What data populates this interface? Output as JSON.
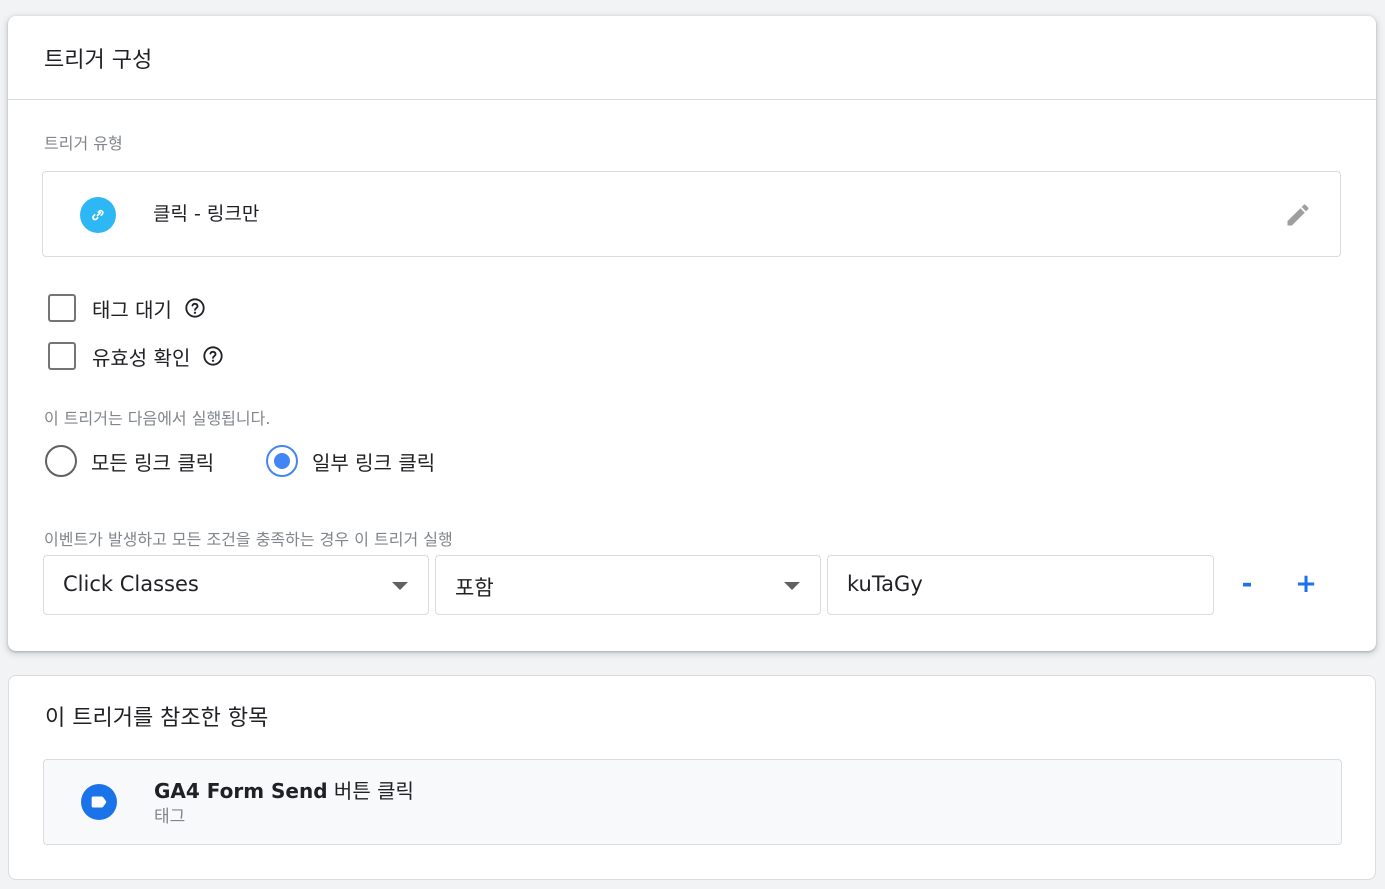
{
  "config": {
    "title": "트리거 구성",
    "type_label": "트리거 유형",
    "trigger_type": "클릭 - 링크만",
    "checkboxes": [
      {
        "label": "태그 대기",
        "checked": false
      },
      {
        "label": "유효성 확인",
        "checked": false
      }
    ],
    "fires_on_label": "이 트리거는 다음에서 실행됩니다.",
    "radio_options": [
      {
        "label": "모든 링크 클릭",
        "selected": false
      },
      {
        "label": "일부 링크 클릭",
        "selected": true
      }
    ],
    "condition_label": "이벤트가 발생하고 모든 조건을 충족하는 경우 이 트리거 실행",
    "condition": {
      "variable": "Click Classes",
      "operator": "포함",
      "value": "kuTaGy"
    },
    "remove_label": "-",
    "add_label": "+"
  },
  "references": {
    "title": "이 트리거를 참조한 항목",
    "items": [
      {
        "name_bold": "GA4 Form Send",
        "name_rest": " 버튼 클릭",
        "kind": "태그"
      }
    ]
  },
  "colors": {
    "link_icon_bg": "#2db7f5",
    "tag_icon_bg": "#1a73e8",
    "accent": "#4285f4"
  }
}
